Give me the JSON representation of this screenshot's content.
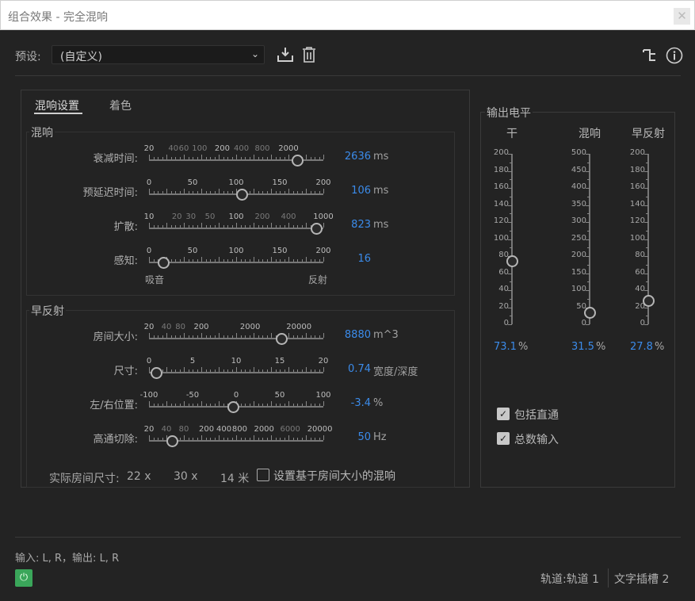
{
  "window": {
    "title": "组合效果 - 完全混响",
    "close_icon": "✕"
  },
  "preset": {
    "label": "预设:",
    "value": "(自定义)"
  },
  "tabs": [
    {
      "label": "混响设置"
    },
    {
      "label": "着色"
    }
  ],
  "reverb_group": {
    "title": "混响",
    "params": [
      {
        "label": "衰减时间:",
        "value": "2636",
        "unit": "ms",
        "level": 0.85,
        "ticks": [
          {
            "t": "20",
            "p": 0.0,
            "b": 1
          },
          {
            "t": "40",
            "p": 0.14,
            "b": 0
          },
          {
            "t": "60",
            "p": 0.2,
            "b": 0
          },
          {
            "t": "100",
            "p": 0.29,
            "b": 0
          },
          {
            "t": "200",
            "p": 0.42,
            "b": 1
          },
          {
            "t": "400",
            "p": 0.53,
            "b": 0
          },
          {
            "t": "800",
            "p": 0.65,
            "b": 0
          },
          {
            "t": "2000",
            "p": 0.8,
            "b": 1
          }
        ]
      },
      {
        "label": "预延迟时间:",
        "value": "106",
        "unit": "ms",
        "level": 0.53,
        "ticks": [
          {
            "t": "0",
            "p": 0.0,
            "b": 1
          },
          {
            "t": "50",
            "p": 0.25,
            "b": 1
          },
          {
            "t": "100",
            "p": 0.5,
            "b": 1
          },
          {
            "t": "150",
            "p": 0.75,
            "b": 1
          },
          {
            "t": "200",
            "p": 1.0,
            "b": 1
          }
        ]
      },
      {
        "label": "扩散:",
        "value": "823",
        "unit": "ms",
        "level": 0.96,
        "ticks": [
          {
            "t": "10",
            "p": 0.0,
            "b": 1
          },
          {
            "t": "20",
            "p": 0.16,
            "b": 0
          },
          {
            "t": "30",
            "p": 0.24,
            "b": 0
          },
          {
            "t": "50",
            "p": 0.35,
            "b": 0
          },
          {
            "t": "100",
            "p": 0.5,
            "b": 1
          },
          {
            "t": "200",
            "p": 0.65,
            "b": 0
          },
          {
            "t": "400",
            "p": 0.8,
            "b": 0
          },
          {
            "t": "1000",
            "p": 1.0,
            "b": 1
          }
        ]
      },
      {
        "label": "感知:",
        "value": "16",
        "unit": "",
        "level": 0.08,
        "ticks": [
          {
            "t": "0",
            "p": 0.0,
            "b": 1
          },
          {
            "t": "50",
            "p": 0.25,
            "b": 1
          },
          {
            "t": "100",
            "p": 0.5,
            "b": 1
          },
          {
            "t": "150",
            "p": 0.75,
            "b": 1
          },
          {
            "t": "200",
            "p": 1.0,
            "b": 1
          }
        ],
        "min_label": "吸音",
        "max_label": "反射"
      }
    ]
  },
  "early_group": {
    "title": "早反射",
    "params": [
      {
        "label": "房间大小:",
        "value": "8880",
        "unit": "m^3",
        "level": 0.76,
        "ticks": [
          {
            "t": "20",
            "p": 0.0,
            "b": 1
          },
          {
            "t": "40",
            "p": 0.1,
            "b": 0
          },
          {
            "t": "80",
            "p": 0.18,
            "b": 0
          },
          {
            "t": "200",
            "p": 0.3,
            "b": 1
          },
          {
            "t": "2000",
            "p": 0.58,
            "b": 1
          },
          {
            "t": "20000",
            "p": 0.86,
            "b": 1
          }
        ]
      },
      {
        "label": "尺寸:",
        "value": "0.74",
        "unit": "宽度/深度",
        "level": 0.04,
        "ticks": [
          {
            "t": "0",
            "p": 0.0,
            "b": 1
          },
          {
            "t": "5",
            "p": 0.25,
            "b": 1
          },
          {
            "t": "10",
            "p": 0.5,
            "b": 1
          },
          {
            "t": "15",
            "p": 0.75,
            "b": 1
          },
          {
            "t": "20",
            "p": 1.0,
            "b": 1
          }
        ]
      },
      {
        "label": "左/右位置:",
        "value": "-3.4",
        "unit": "%",
        "level": 0.48,
        "ticks": [
          {
            "t": "-100",
            "p": 0.0,
            "b": 1
          },
          {
            "t": "-50",
            "p": 0.25,
            "b": 1
          },
          {
            "t": "0",
            "p": 0.5,
            "b": 1
          },
          {
            "t": "50",
            "p": 0.75,
            "b": 1
          },
          {
            "t": "100",
            "p": 1.0,
            "b": 1
          }
        ]
      },
      {
        "label": "高通切除:",
        "value": "50",
        "unit": "Hz",
        "level": 0.13,
        "ticks": [
          {
            "t": "20",
            "p": 0.0,
            "b": 1
          },
          {
            "t": "40",
            "p": 0.1,
            "b": 0
          },
          {
            "t": "80",
            "p": 0.2,
            "b": 0
          },
          {
            "t": "200",
            "p": 0.33,
            "b": 1
          },
          {
            "t": "400",
            "p": 0.43,
            "b": 1
          },
          {
            "t": "800",
            "p": 0.52,
            "b": 1
          },
          {
            "t": "2000",
            "p": 0.66,
            "b": 1
          },
          {
            "t": "6000",
            "p": 0.81,
            "b": 0
          },
          {
            "t": "20000",
            "p": 0.98,
            "b": 1
          }
        ]
      }
    ],
    "room": {
      "label": "实际房间尺寸:",
      "w": "22 x",
      "d": "30 x",
      "h": "14 米"
    },
    "room_checkbox": {
      "label": "设置基于房间大小的混响",
      "checked": false
    }
  },
  "output": {
    "title": "输出电平",
    "channels": [
      {
        "label": "干",
        "value": "73.1",
        "unit": "%",
        "level": 0.37,
        "scale": [
          "200",
          "180",
          "160",
          "140",
          "120",
          "100",
          "80",
          "60",
          "40",
          "20",
          "0"
        ]
      },
      {
        "label": "混响",
        "value": "31.5",
        "unit": "%",
        "level": 0.07,
        "scale": [
          "500",
          "450",
          "400",
          "350",
          "300",
          "250",
          "200",
          "150",
          "100",
          "50",
          "0"
        ]
      },
      {
        "label": "早反射",
        "value": "27.8",
        "unit": "%",
        "level": 0.14,
        "scale": [
          "200",
          "180",
          "160",
          "140",
          "120",
          "100",
          "80",
          "60",
          "40",
          "20",
          "0"
        ]
      }
    ],
    "include_dry": {
      "label": "包括直通",
      "checked": true
    },
    "sum_inputs": {
      "label": "总数输入",
      "checked": true
    }
  },
  "footer": {
    "io": "输入: L, R，输出: L, R",
    "track": "轨道:轨道 1",
    "slot": "文字插槽 2",
    "power_icon": "⏻"
  },
  "colors": {
    "accent": "#3b8bea",
    "power": "#3aa65a",
    "background": "#232323"
  }
}
